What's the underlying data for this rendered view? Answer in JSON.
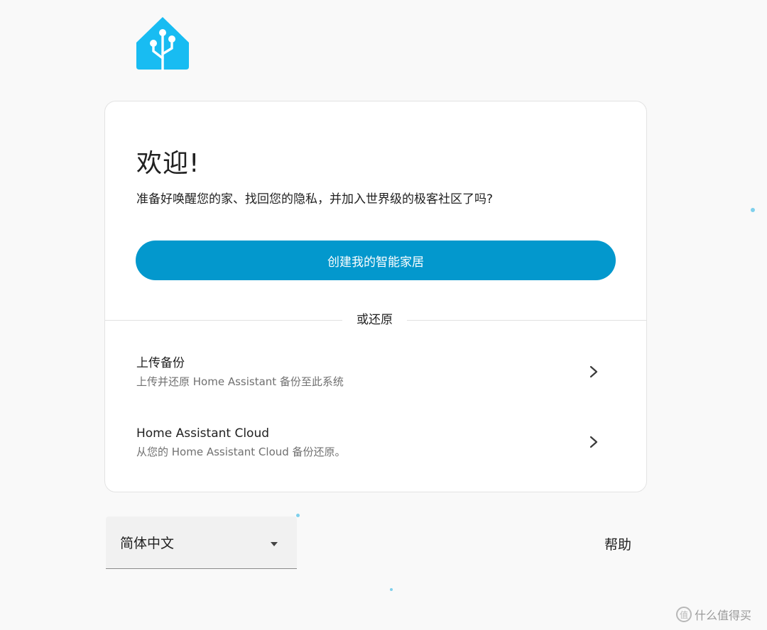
{
  "brand": {
    "logo_icon": "home-assistant-logo-icon",
    "color": "#18bcf2"
  },
  "welcome": {
    "title": "欢迎!",
    "subtitle": "准备好唤醒您的家、找回您的隐私，并加入世界级的极客社区了吗?",
    "primary_button": "创建我的智能家居",
    "primary_color": "#0398cd"
  },
  "divider": {
    "label": "或还原"
  },
  "restore_options": [
    {
      "title": "上传备份",
      "description": "上传并还原 Home Assistant 备份至此系统",
      "icon": "chevron-right-icon"
    },
    {
      "title": "Home Assistant Cloud",
      "description": "从您的 Home Assistant Cloud 备份还原。",
      "icon": "chevron-right-icon"
    }
  ],
  "footer": {
    "language": {
      "value": "简体中文",
      "icon": "arrow-drop-down-icon"
    },
    "help_label": "帮助"
  },
  "watermark": {
    "text": "什么值得买"
  }
}
